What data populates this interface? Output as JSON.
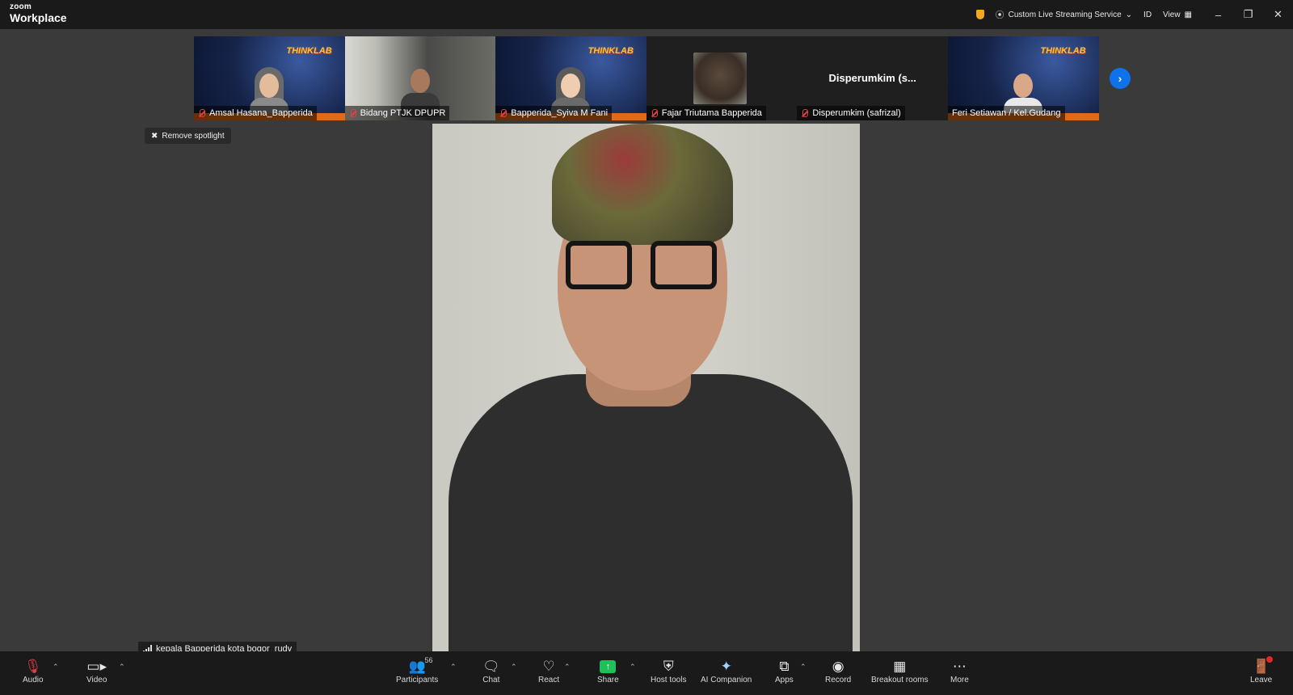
{
  "app": {
    "logo_top": "zoom",
    "logo_bottom": "Workplace",
    "streaming_label": "Custom Live Streaming Service",
    "id_label": "ID",
    "view_label": "View",
    "shield_color": "#f5a623"
  },
  "strip": {
    "tiles": [
      {
        "name": "Amsal Hasana_Bapperida",
        "badge": "THINKLAB"
      },
      {
        "name": "Bidang PTJK DPUPR"
      },
      {
        "name": "Bapperida_Syiva M Fani",
        "badge": "THINKLAB"
      },
      {
        "name": "Fajar Triutama Bapperida"
      },
      {
        "name": "Disperumkim (safrizal)",
        "center_text": "Disperumkim (s..."
      },
      {
        "name": "Feri Setiawan / Kel.Gudang",
        "badge": "THINKLAB"
      }
    ],
    "next_icon": "chevron-right-icon"
  },
  "spotlight": {
    "label": "Remove spotlight"
  },
  "main": {
    "speaker_name": "kepala Bapperida kota bogor_rudy"
  },
  "toolbar": {
    "audio": "Audio",
    "video": "Video",
    "participants": "Participants",
    "participants_count": "56",
    "chat": "Chat",
    "react": "React",
    "share": "Share",
    "host_tools": "Host tools",
    "ai_companion": "AI Companion",
    "apps": "Apps",
    "record": "Record",
    "breakout_rooms": "Breakout rooms",
    "more": "More",
    "leave": "Leave",
    "share_color": "#1fbf5a",
    "leave_color": "#e02828",
    "accent": "#0e72ed"
  }
}
